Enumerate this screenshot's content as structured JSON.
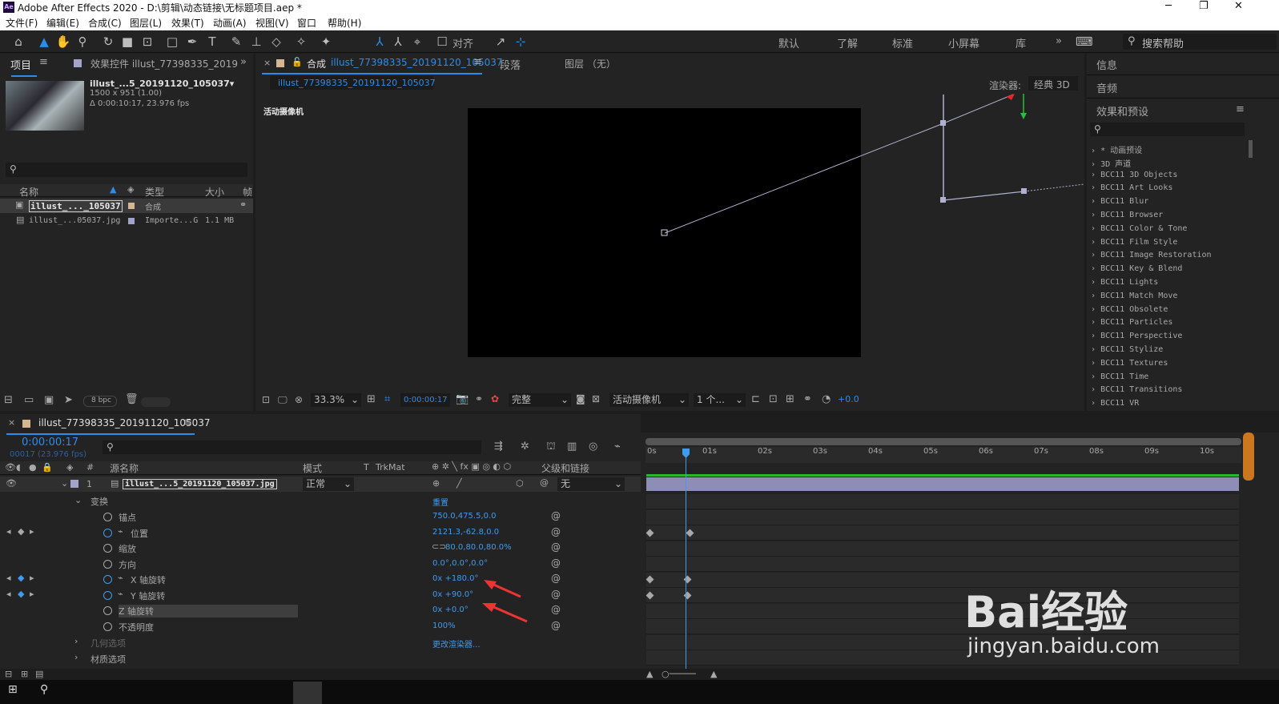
{
  "window": {
    "title": "Adobe After Effects 2020 - D:\\剪辑\\动态链接\\无标题项目.aep *",
    "logo": "Ae"
  },
  "menu": [
    "文件(F)",
    "编辑(E)",
    "合成(C)",
    "图层(L)",
    "效果(T)",
    "动画(A)",
    "视图(V)",
    "窗口",
    "帮助(H)"
  ],
  "toolbar": {
    "align_label": "对齐",
    "workspaces": [
      "默认",
      "了解",
      "标准",
      "小屏幕",
      "库"
    ],
    "search_placeholder": "搜索帮助"
  },
  "project_panel": {
    "tab_project": "项目",
    "tab_effects": "效果控件 illust_77398335_2019",
    "thumb_name": "illust_...5_20191120_105037▾",
    "thumb_dim": "1500 x 951 (1.00)",
    "thumb_dur": "Δ 0:00:10:17, 23.976 fps",
    "columns": {
      "name": "名称",
      "type": "类型",
      "size": "大小",
      "frame": "帧"
    },
    "items": [
      {
        "name": "illust_..._105037",
        "type": "合成",
        "size": ""
      },
      {
        "name": "illust_...05037.jpg",
        "type": "Importe...G",
        "size": "1.1 MB"
      }
    ],
    "bpc": "8 bpc"
  },
  "comp_panel": {
    "tab_comp_prefix": "合成",
    "tab_comp_name": "illust_77398335_20191120_105037",
    "tab_paragraph": "段落",
    "tab_layer": "图层 （无）",
    "sub_tab": "illust_77398335_20191120_105037",
    "renderer_label": "渲染器:",
    "renderer_value": "经典 3D",
    "camera_label": "活动摄像机",
    "zoom": "33.3%",
    "timecode": "0:00:00:17",
    "resolution": "完整",
    "view": "活动摄像机",
    "views_count": "1 个...",
    "exposure": "+0.0"
  },
  "right_panel": {
    "info": "信息",
    "audio": "音频",
    "effects_title": "效果和预设",
    "search_placeholder": "",
    "items": [
      "* 动画预设",
      "3D 声道",
      "BCC11 3D Objects",
      "BCC11 Art Looks",
      "BCC11 Blur",
      "BCC11 Browser",
      "BCC11 Color & Tone",
      "BCC11 Film Style",
      "BCC11 Image Restoration",
      "BCC11 Key & Blend",
      "BCC11 Lights",
      "BCC11 Match Move",
      "BCC11 Obsolete",
      "BCC11 Particles",
      "BCC11 Perspective",
      "BCC11 Stylize",
      "BCC11 Textures",
      "BCC11 Time",
      "BCC11 Transitions",
      "BCC11 VR"
    ]
  },
  "timeline": {
    "tab_name": "illust_77398335_20191120_105037",
    "timecode": "0:00:00:17",
    "frame_info": "00017 (23.976 fps)",
    "headers": {
      "hash": "#",
      "source": "源名称",
      "mode": "模式",
      "t": "T",
      "trkmat": "TrkMat",
      "parent": "父级和链接"
    },
    "layer": {
      "num": "1",
      "name": "illust_...5_20191120_105037.jpg",
      "mode": "正常",
      "parent": "无"
    },
    "transform": "变换",
    "reset": "重置",
    "props": [
      {
        "name": "锚点",
        "value": "750.0,475.5,0.0"
      },
      {
        "name": "位置",
        "value": "2121.3,-62.8,0.0"
      },
      {
        "name": "缩放",
        "value": "80.0,80.0,80.0%"
      },
      {
        "name": "方向",
        "value": "0.0°,0.0°,0.0°"
      },
      {
        "name": "X 轴旋转",
        "value": "0x +180.0°"
      },
      {
        "name": "Y 轴旋转",
        "value": "0x +90.0°"
      },
      {
        "name": "Z 轴旋转",
        "value": "0x +0.0°"
      },
      {
        "name": "不透明度",
        "value": "100%"
      }
    ],
    "geometry": "几何选项",
    "geometry_value": "更改渲染器...",
    "material": "材质选项",
    "ruler": [
      "0s",
      "01s",
      "02s",
      "03s",
      "04s",
      "05s",
      "06s",
      "07s",
      "08s",
      "09s",
      "10s"
    ]
  },
  "watermark": {
    "brand": "Bai经验",
    "url": "jingyan.baidu.com"
  },
  "colors": {
    "accent": "#2d8ceb",
    "layer_bar": "#a3a3c9",
    "panel": "#232323",
    "annotation": "#ee3333"
  }
}
